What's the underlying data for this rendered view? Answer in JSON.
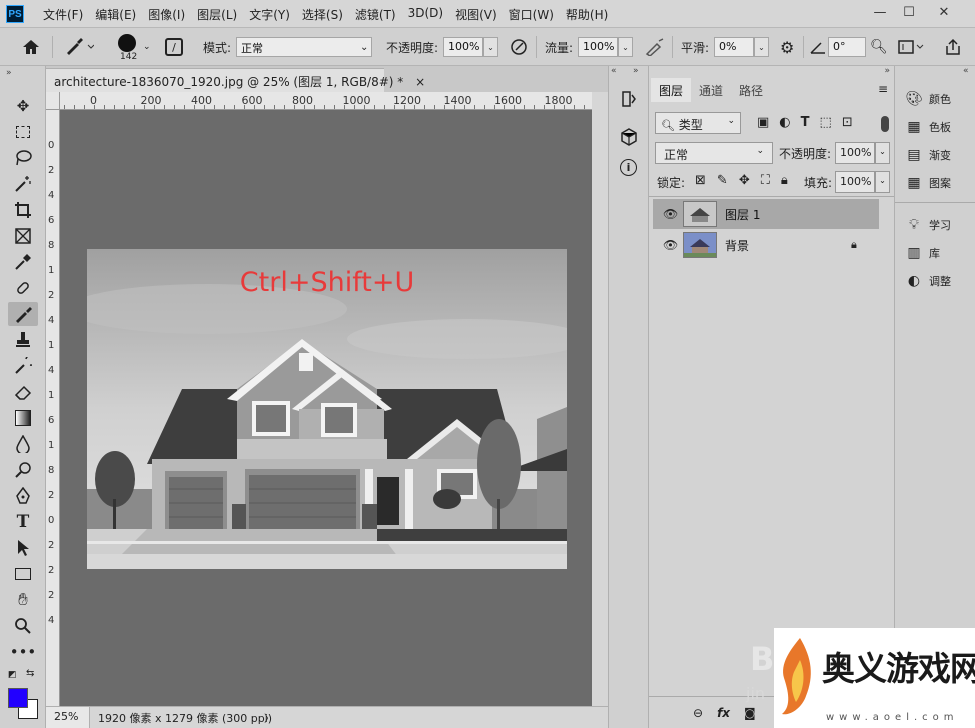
{
  "menubar": {
    "app_icon": "PS",
    "items": [
      "文件(F)",
      "编辑(E)",
      "图像(I)",
      "图层(L)",
      "文字(Y)",
      "选择(S)",
      "滤镜(T)",
      "3D(D)",
      "视图(V)",
      "窗口(W)",
      "帮助(H)"
    ],
    "minimize": "—",
    "maximize": "☐",
    "close": "✕"
  },
  "options": {
    "brush_size": "142",
    "mode_label": "模式:",
    "mode_value": "正常",
    "opacity_label": "不透明度:",
    "opacity_value": "100%",
    "flow_label": "流量:",
    "flow_value": "100%",
    "smooth_label": "平滑:",
    "smooth_value": "0%",
    "angle_value": "0°"
  },
  "document": {
    "tab_title": "architecture-1836070_1920.jpg @ 25% (图层 1, RGB/8#) *",
    "close": "×",
    "overlay_text": "Ctrl+Shift+U"
  },
  "ruler": {
    "h_ticks": [
      "0",
      "200",
      "400",
      "600",
      "800",
      "1000",
      "1200",
      "1400",
      "1600",
      "1800"
    ],
    "v_ticks": [
      "0",
      "2",
      "4",
      "6",
      "8",
      "1",
      "2",
      "4",
      "1",
      "4",
      "1",
      "6",
      "1",
      "8",
      "2",
      "0",
      "2",
      "2",
      "2",
      "4"
    ]
  },
  "status": {
    "zoom": "25%",
    "dimensions": "1920 像素 x 1279 像素 (300 ppi)",
    "arrow": "〉"
  },
  "layers": {
    "tabs": [
      "图层",
      "通道",
      "路径"
    ],
    "filter_label": "类型",
    "blend_mode": "正常",
    "opacity_label": "不透明度:",
    "opacity_value": "100%",
    "lock_label": "锁定:",
    "fill_label": "填充:",
    "fill_value": "100%",
    "items": [
      {
        "name": "图层 1",
        "selected": true,
        "locked": false
      },
      {
        "name": "背景",
        "selected": false,
        "locked": true
      }
    ]
  },
  "right_dock": {
    "items": [
      "颜色",
      "色板",
      "渐变",
      "图案",
      "学习",
      "库",
      "调整"
    ]
  },
  "colors": {
    "foreground": "#2200ff",
    "background": "#ffffff",
    "overlay": "#e83a3a"
  },
  "watermark": {
    "text": "奥义游戏网",
    "url": "www.aoel.com",
    "bg_letters": "B",
    "bg_letters2": "jin"
  }
}
